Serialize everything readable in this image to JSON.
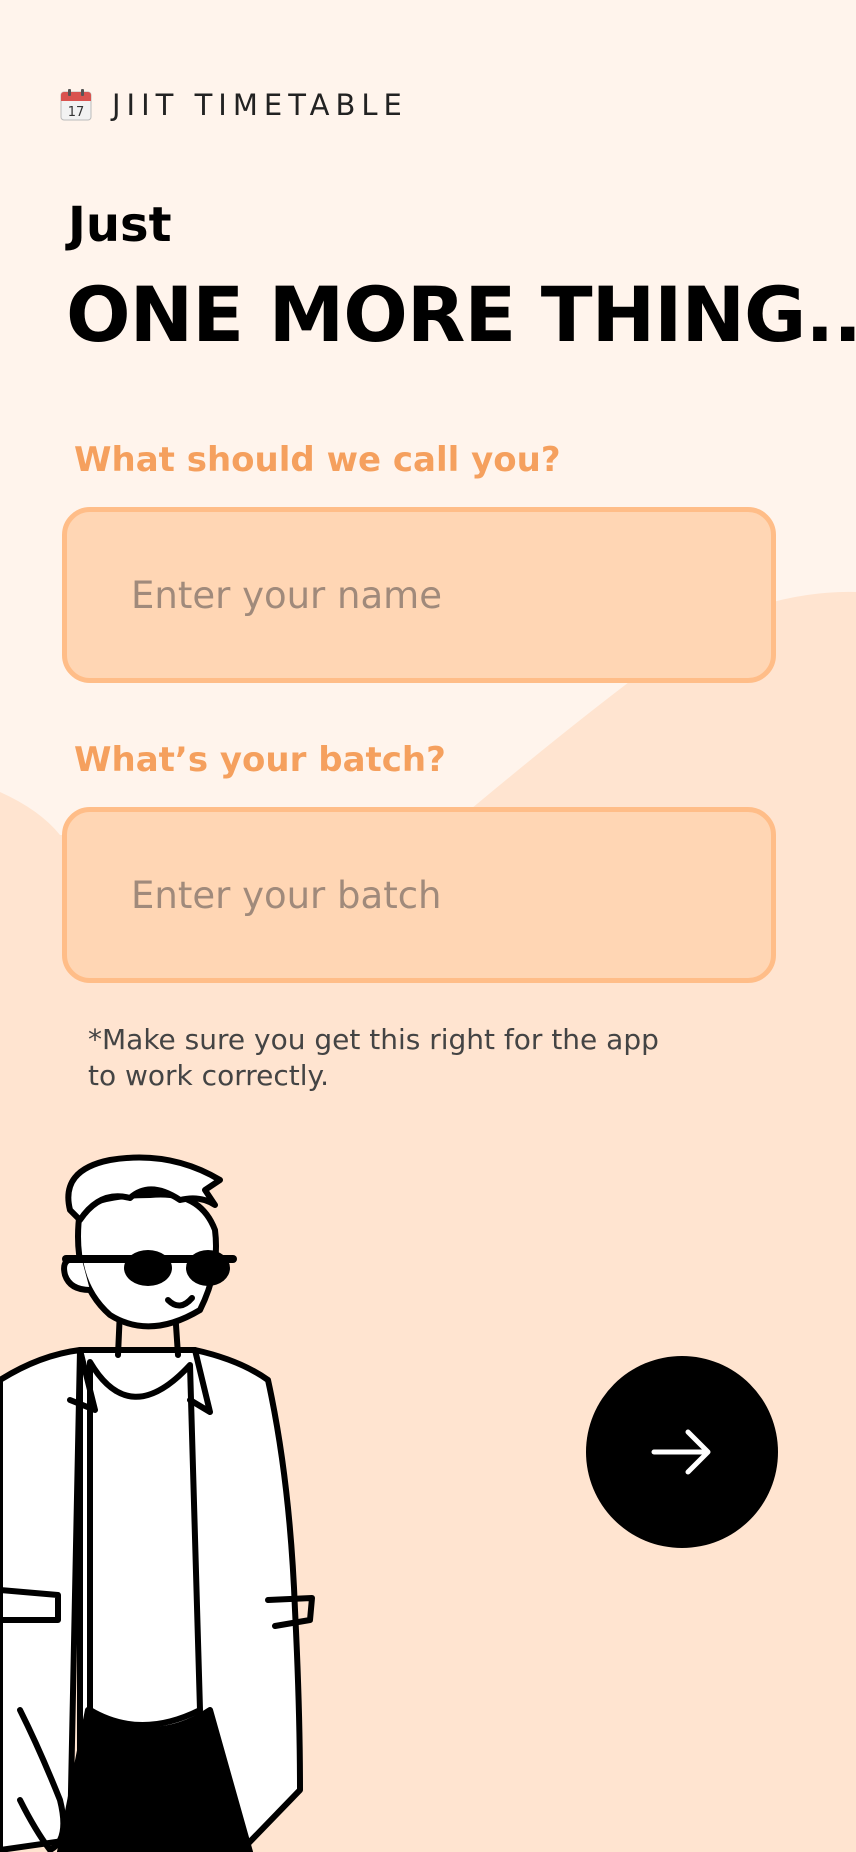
{
  "header": {
    "icon": "calendar-icon",
    "title": "JIIT TIMETABLE"
  },
  "hero": {
    "subtitle": "Just",
    "headline": "ONE MORE THING..."
  },
  "form": {
    "name": {
      "label": "What should we call you?",
      "placeholder": "Enter your name",
      "value": ""
    },
    "batch": {
      "label": "What’s your batch?",
      "placeholder": "Enter your batch",
      "value": ""
    },
    "note": "*Make sure you get this right for the app to work correctly."
  },
  "next_button": {
    "icon": "arrow-right-icon"
  },
  "illustration": {
    "icon": "person-with-sunglasses-illustration"
  },
  "colors": {
    "background": "#fff4ec",
    "wave": "#ffe4d0",
    "accent_label": "#f5a05e",
    "input_fill": "#ffd6b4",
    "input_border": "#ffbd88",
    "button": "#000000"
  }
}
